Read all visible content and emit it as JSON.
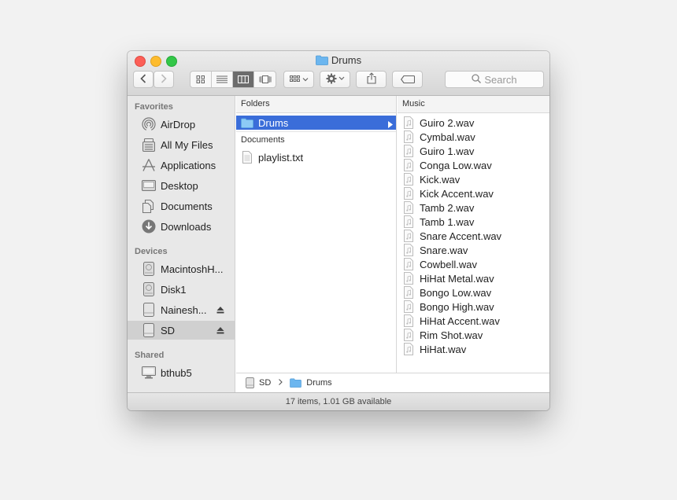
{
  "window": {
    "title": "Drums"
  },
  "toolbar": {
    "back_icon": "chevron-left-icon",
    "forward_icon": "chevron-right-icon",
    "view_modes": [
      "icon-view-icon",
      "list-view-icon",
      "column-view-icon",
      "coverflow-view-icon"
    ],
    "active_view": "column",
    "arrange_icon": "arrange-icon",
    "action_icon": "gear-icon",
    "share_icon": "share-icon",
    "tag_icon": "tag-icon",
    "search_placeholder": "Search"
  },
  "sidebar": {
    "favorites_label": "Favorites",
    "favorites": [
      {
        "label": "AirDrop",
        "icon": "airdrop-icon"
      },
      {
        "label": "All My Files",
        "icon": "all-files-icon"
      },
      {
        "label": "Applications",
        "icon": "applications-icon"
      },
      {
        "label": "Desktop",
        "icon": "desktop-icon"
      },
      {
        "label": "Documents",
        "icon": "documents-icon"
      },
      {
        "label": "Downloads",
        "icon": "downloads-icon"
      }
    ],
    "devices_label": "Devices",
    "devices": [
      {
        "label": "MacintoshH...",
        "icon": "hard-drive-icon",
        "eject": false
      },
      {
        "label": "Disk1",
        "icon": "disk-icon",
        "eject": false
      },
      {
        "label": "Nainesh...",
        "icon": "external-drive-icon",
        "eject": true
      },
      {
        "label": "SD",
        "icon": "sd-card-icon",
        "eject": true,
        "selected": true
      }
    ],
    "shared_label": "Shared",
    "shared": [
      {
        "label": "bthub5",
        "icon": "computer-icon"
      }
    ]
  },
  "columns": {
    "folders": {
      "header": "Folders",
      "items": [
        {
          "label": "Drums",
          "selected": true
        }
      ],
      "documents_header": "Documents",
      "documents": [
        {
          "label": "playlist.txt"
        }
      ]
    },
    "music": {
      "header": "Music",
      "items": [
        "Guiro 2.wav",
        "Cymbal.wav",
        "Guiro 1.wav",
        "Conga Low.wav",
        "Kick.wav",
        "Kick Accent.wav",
        "Tamb 2.wav",
        "Tamb 1.wav",
        "Snare Accent.wav",
        "Snare.wav",
        "Cowbell.wav",
        "HiHat Metal.wav",
        "Bongo Low.wav",
        "Bongo High.wav",
        "HiHat Accent.wav",
        "Rim Shot.wav",
        "HiHat.wav"
      ]
    }
  },
  "pathbar": {
    "segments": [
      "SD",
      "Drums"
    ]
  },
  "statusbar": {
    "text": "17 items, 1.01 GB available"
  },
  "colors": {
    "selection": "#3a6dd9",
    "folder": "#6cb6ef"
  }
}
